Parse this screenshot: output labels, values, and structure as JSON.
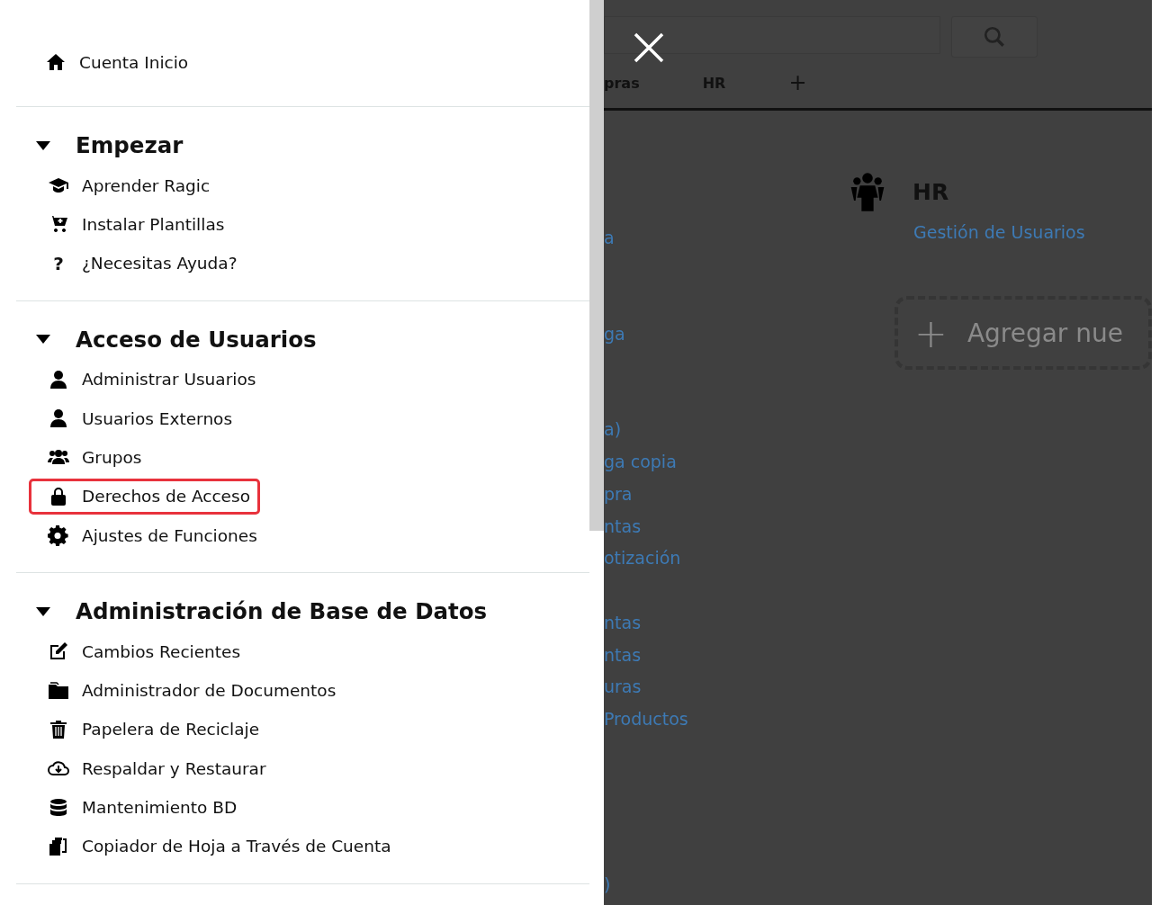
{
  "menu": {
    "home": {
      "label": "Cuenta Inicio"
    },
    "sections": [
      {
        "title": "Empezar",
        "expanded": true,
        "items": [
          {
            "label": "Aprender Ragic",
            "highlighted": false
          },
          {
            "label": "Instalar Plantillas",
            "highlighted": false
          },
          {
            "label": "¿Necesitas Ayuda?",
            "glyph": "?",
            "highlighted": false
          }
        ]
      },
      {
        "title": "Acceso de Usuarios",
        "expanded": true,
        "items": [
          {
            "label": "Administrar Usuarios",
            "highlighted": false
          },
          {
            "label": "Usuarios Externos",
            "highlighted": false
          },
          {
            "label": "Grupos",
            "highlighted": false
          },
          {
            "label": "Derechos de Acceso",
            "highlighted": true
          },
          {
            "label": "Ajustes de Funciones",
            "highlighted": false
          }
        ]
      },
      {
        "title": "Administración de Base de Datos",
        "expanded": true,
        "items": [
          {
            "label": "Cambios Recientes",
            "highlighted": false
          },
          {
            "label": "Administrador de Documentos",
            "highlighted": false
          },
          {
            "label": "Papelera de Reciclaje",
            "highlighted": false
          },
          {
            "label": "Respaldar y Restaurar",
            "highlighted": false
          },
          {
            "label": "Mantenimiento BD",
            "highlighted": false
          },
          {
            "label": "Copiador de Hoja a Través de Cuenta",
            "highlighted": false
          }
        ]
      }
    ]
  },
  "background": {
    "tabs": [
      {
        "label": "pras",
        "kind": "text"
      },
      {
        "label": "HR",
        "kind": "text"
      },
      {
        "label": "+",
        "kind": "add"
      }
    ],
    "link_groups": [
      [
        "a"
      ],
      [
        "ga"
      ],
      [
        "a)",
        "ga copia",
        "pra",
        "ntas",
        "otización"
      ],
      [
        "ntas",
        "ntas",
        "uras",
        "Productos"
      ],
      [
        ")"
      ]
    ],
    "app": {
      "title": "HR",
      "link": "Gestión de Usuarios"
    },
    "add_card": {
      "label": "Agregar nue",
      "icon": "+"
    }
  }
}
